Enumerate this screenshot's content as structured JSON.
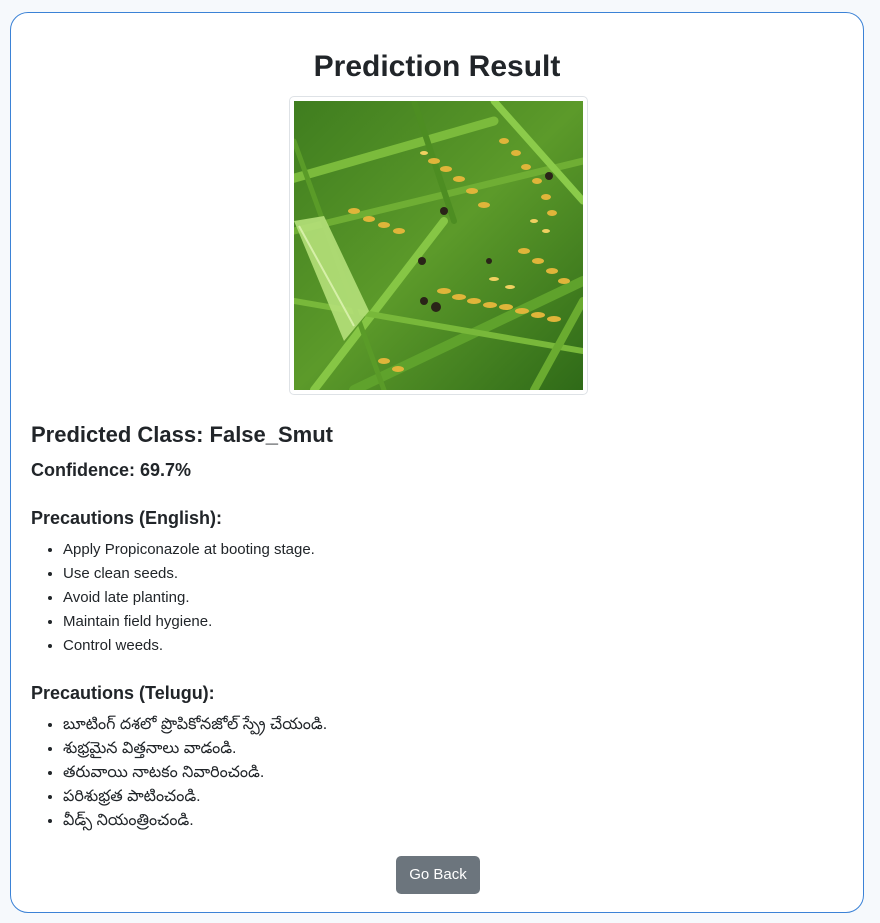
{
  "page": {
    "title": "Prediction Result"
  },
  "image": {
    "subject": "rice-panicle-photo",
    "alt": "Uploaded rice crop image"
  },
  "result": {
    "predicted_class_label": "Predicted Class: False_Smut",
    "confidence_label": "Confidence: 69.7%"
  },
  "precautions_english": {
    "heading": "Precautions (English):",
    "items": [
      "Apply Propiconazole at booting stage.",
      "Use clean seeds.",
      "Avoid late planting.",
      "Maintain field hygiene.",
      "Control weeds."
    ]
  },
  "precautions_telugu": {
    "heading": "Precautions (Telugu):",
    "items": [
      "బూటింగ్ దశలో ప్రొపికోనజోల్ స్ప్రే చేయండి.",
      "శుభ్రమైన విత్తనాలు వాడండి.",
      "తరువాయి నాటకం నివారించండి.",
      "పరిశుభ్రత పాటించండి.",
      "వీడ్స్ నియంత్రించండి."
    ]
  },
  "actions": {
    "back_label": "Go Back"
  },
  "colors": {
    "card_border": "#3b82d6",
    "button_bg": "#6c757d",
    "text": "#212529"
  }
}
